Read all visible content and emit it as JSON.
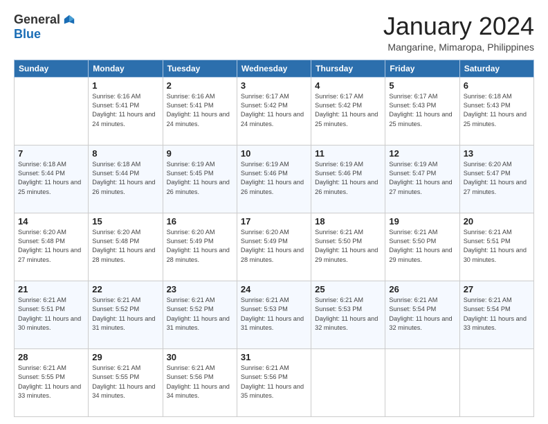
{
  "header": {
    "logo_general": "General",
    "logo_blue": "Blue",
    "title": "January 2024",
    "subtitle": "Mangarine, Mimaropa, Philippines"
  },
  "days_of_week": [
    "Sunday",
    "Monday",
    "Tuesday",
    "Wednesday",
    "Thursday",
    "Friday",
    "Saturday"
  ],
  "weeks": [
    [
      {
        "day": "",
        "sunrise": "",
        "sunset": "",
        "daylight": ""
      },
      {
        "day": "1",
        "sunrise": "Sunrise: 6:16 AM",
        "sunset": "Sunset: 5:41 PM",
        "daylight": "Daylight: 11 hours and 24 minutes."
      },
      {
        "day": "2",
        "sunrise": "Sunrise: 6:16 AM",
        "sunset": "Sunset: 5:41 PM",
        "daylight": "Daylight: 11 hours and 24 minutes."
      },
      {
        "day": "3",
        "sunrise": "Sunrise: 6:17 AM",
        "sunset": "Sunset: 5:42 PM",
        "daylight": "Daylight: 11 hours and 24 minutes."
      },
      {
        "day": "4",
        "sunrise": "Sunrise: 6:17 AM",
        "sunset": "Sunset: 5:42 PM",
        "daylight": "Daylight: 11 hours and 25 minutes."
      },
      {
        "day": "5",
        "sunrise": "Sunrise: 6:17 AM",
        "sunset": "Sunset: 5:43 PM",
        "daylight": "Daylight: 11 hours and 25 minutes."
      },
      {
        "day": "6",
        "sunrise": "Sunrise: 6:18 AM",
        "sunset": "Sunset: 5:43 PM",
        "daylight": "Daylight: 11 hours and 25 minutes."
      }
    ],
    [
      {
        "day": "7",
        "sunrise": "Sunrise: 6:18 AM",
        "sunset": "Sunset: 5:44 PM",
        "daylight": "Daylight: 11 hours and 25 minutes."
      },
      {
        "day": "8",
        "sunrise": "Sunrise: 6:18 AM",
        "sunset": "Sunset: 5:44 PM",
        "daylight": "Daylight: 11 hours and 26 minutes."
      },
      {
        "day": "9",
        "sunrise": "Sunrise: 6:19 AM",
        "sunset": "Sunset: 5:45 PM",
        "daylight": "Daylight: 11 hours and 26 minutes."
      },
      {
        "day": "10",
        "sunrise": "Sunrise: 6:19 AM",
        "sunset": "Sunset: 5:46 PM",
        "daylight": "Daylight: 11 hours and 26 minutes."
      },
      {
        "day": "11",
        "sunrise": "Sunrise: 6:19 AM",
        "sunset": "Sunset: 5:46 PM",
        "daylight": "Daylight: 11 hours and 26 minutes."
      },
      {
        "day": "12",
        "sunrise": "Sunrise: 6:19 AM",
        "sunset": "Sunset: 5:47 PM",
        "daylight": "Daylight: 11 hours and 27 minutes."
      },
      {
        "day": "13",
        "sunrise": "Sunrise: 6:20 AM",
        "sunset": "Sunset: 5:47 PM",
        "daylight": "Daylight: 11 hours and 27 minutes."
      }
    ],
    [
      {
        "day": "14",
        "sunrise": "Sunrise: 6:20 AM",
        "sunset": "Sunset: 5:48 PM",
        "daylight": "Daylight: 11 hours and 27 minutes."
      },
      {
        "day": "15",
        "sunrise": "Sunrise: 6:20 AM",
        "sunset": "Sunset: 5:48 PM",
        "daylight": "Daylight: 11 hours and 28 minutes."
      },
      {
        "day": "16",
        "sunrise": "Sunrise: 6:20 AM",
        "sunset": "Sunset: 5:49 PM",
        "daylight": "Daylight: 11 hours and 28 minutes."
      },
      {
        "day": "17",
        "sunrise": "Sunrise: 6:20 AM",
        "sunset": "Sunset: 5:49 PM",
        "daylight": "Daylight: 11 hours and 28 minutes."
      },
      {
        "day": "18",
        "sunrise": "Sunrise: 6:21 AM",
        "sunset": "Sunset: 5:50 PM",
        "daylight": "Daylight: 11 hours and 29 minutes."
      },
      {
        "day": "19",
        "sunrise": "Sunrise: 6:21 AM",
        "sunset": "Sunset: 5:50 PM",
        "daylight": "Daylight: 11 hours and 29 minutes."
      },
      {
        "day": "20",
        "sunrise": "Sunrise: 6:21 AM",
        "sunset": "Sunset: 5:51 PM",
        "daylight": "Daylight: 11 hours and 30 minutes."
      }
    ],
    [
      {
        "day": "21",
        "sunrise": "Sunrise: 6:21 AM",
        "sunset": "Sunset: 5:51 PM",
        "daylight": "Daylight: 11 hours and 30 minutes."
      },
      {
        "day": "22",
        "sunrise": "Sunrise: 6:21 AM",
        "sunset": "Sunset: 5:52 PM",
        "daylight": "Daylight: 11 hours and 31 minutes."
      },
      {
        "day": "23",
        "sunrise": "Sunrise: 6:21 AM",
        "sunset": "Sunset: 5:52 PM",
        "daylight": "Daylight: 11 hours and 31 minutes."
      },
      {
        "day": "24",
        "sunrise": "Sunrise: 6:21 AM",
        "sunset": "Sunset: 5:53 PM",
        "daylight": "Daylight: 11 hours and 31 minutes."
      },
      {
        "day": "25",
        "sunrise": "Sunrise: 6:21 AM",
        "sunset": "Sunset: 5:53 PM",
        "daylight": "Daylight: 11 hours and 32 minutes."
      },
      {
        "day": "26",
        "sunrise": "Sunrise: 6:21 AM",
        "sunset": "Sunset: 5:54 PM",
        "daylight": "Daylight: 11 hours and 32 minutes."
      },
      {
        "day": "27",
        "sunrise": "Sunrise: 6:21 AM",
        "sunset": "Sunset: 5:54 PM",
        "daylight": "Daylight: 11 hours and 33 minutes."
      }
    ],
    [
      {
        "day": "28",
        "sunrise": "Sunrise: 6:21 AM",
        "sunset": "Sunset: 5:55 PM",
        "daylight": "Daylight: 11 hours and 33 minutes."
      },
      {
        "day": "29",
        "sunrise": "Sunrise: 6:21 AM",
        "sunset": "Sunset: 5:55 PM",
        "daylight": "Daylight: 11 hours and 34 minutes."
      },
      {
        "day": "30",
        "sunrise": "Sunrise: 6:21 AM",
        "sunset": "Sunset: 5:56 PM",
        "daylight": "Daylight: 11 hours and 34 minutes."
      },
      {
        "day": "31",
        "sunrise": "Sunrise: 6:21 AM",
        "sunset": "Sunset: 5:56 PM",
        "daylight": "Daylight: 11 hours and 35 minutes."
      },
      {
        "day": "",
        "sunrise": "",
        "sunset": "",
        "daylight": ""
      },
      {
        "day": "",
        "sunrise": "",
        "sunset": "",
        "daylight": ""
      },
      {
        "day": "",
        "sunrise": "",
        "sunset": "",
        "daylight": ""
      }
    ]
  ]
}
